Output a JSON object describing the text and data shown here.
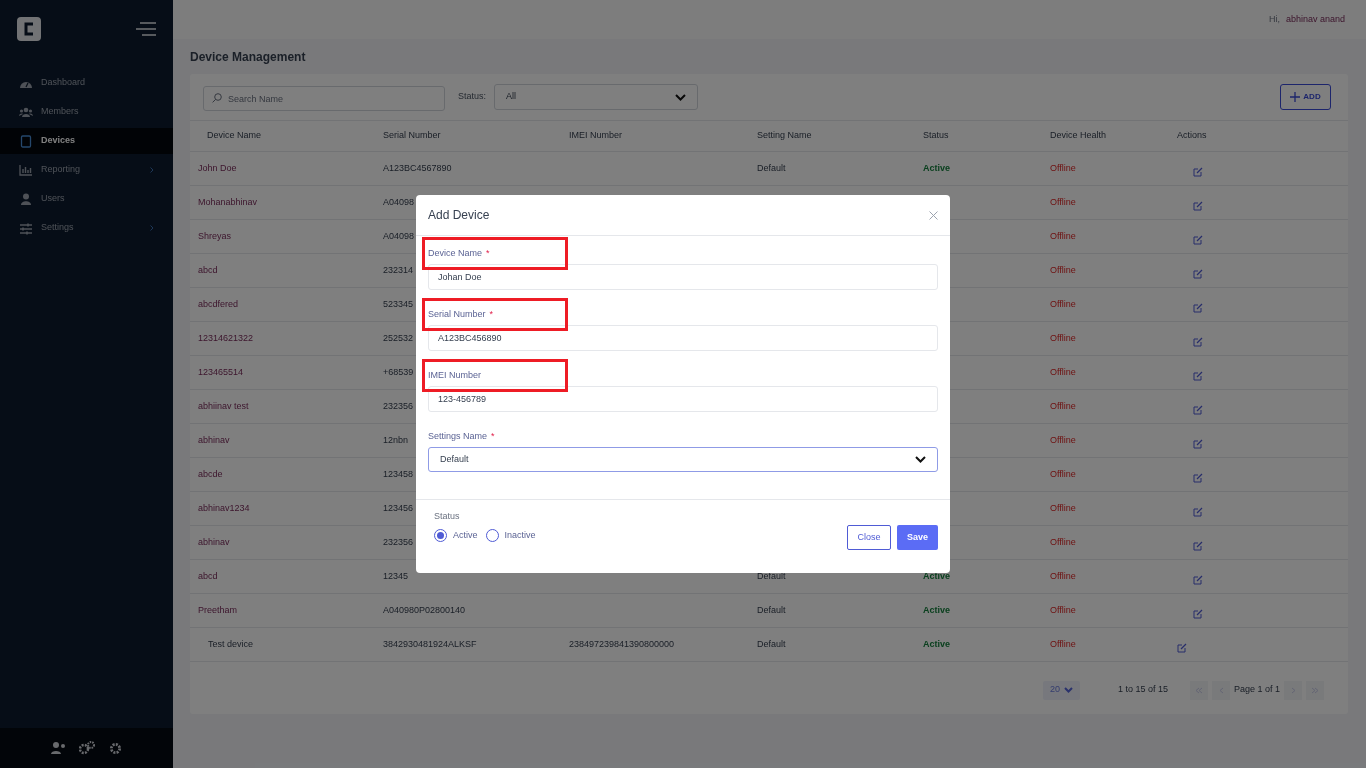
{
  "sidebar": {
    "items": [
      {
        "label": "Dashboard",
        "selected": false,
        "has_submenu": false
      },
      {
        "label": "Members",
        "selected": false,
        "has_submenu": false
      },
      {
        "label": "Devices",
        "selected": true,
        "has_submenu": false
      },
      {
        "label": "Reporting",
        "selected": false,
        "has_submenu": true
      },
      {
        "label": "Users",
        "selected": false,
        "has_submenu": false
      },
      {
        "label": "Settings",
        "selected": false,
        "has_submenu": true
      }
    ]
  },
  "header": {
    "greeting": "Hi,",
    "user_name": "abhinav anand"
  },
  "page_title": "Device Management",
  "toolbar": {
    "search": {
      "placeholder": "Search Name"
    },
    "status_label": "Status:",
    "status_value": "All",
    "add_button": "ADD"
  },
  "table": {
    "columns": [
      "Device Name",
      "Serial Number",
      "IMEI Number",
      "Setting Name",
      "Status",
      "Device Health",
      "Actions"
    ],
    "rows": [
      {
        "device_name": "John Doe",
        "serial_number": "A123BC4567890",
        "setting_name": "Default",
        "status": "Active",
        "health": "Offline"
      },
      {
        "device_name": "Mohanabhinav",
        "serial_number": "A04098",
        "health": "Offline"
      },
      {
        "device_name": "Shreyas",
        "serial_number": "A04098",
        "health": "Offline"
      },
      {
        "device_name": "abcd",
        "serial_number": "232314",
        "health": "Offline"
      },
      {
        "device_name": "abcdfered",
        "serial_number": "523345",
        "health": "Offline"
      },
      {
        "device_name": "12314621322",
        "serial_number": "252532",
        "health": "Offline"
      },
      {
        "device_name": "123465514",
        "serial_number": "+68539",
        "health": "Offline"
      },
      {
        "device_name": "abhiinav test",
        "serial_number": "232356",
        "health": "Offline"
      },
      {
        "device_name": "abhinav",
        "serial_number": "12nbn",
        "health": "Offline"
      },
      {
        "device_name": "abcde",
        "serial_number": "123458",
        "health": "Offline"
      },
      {
        "device_name": "abhinav1234",
        "serial_number": "123456",
        "health": "Offline"
      },
      {
        "device_name": "abhinav",
        "serial_number": "232356",
        "health": "Offline"
      },
      {
        "device_name": "abcd",
        "serial_number": "12345",
        "setting_name": "Default",
        "status": "Active",
        "health": "Offline"
      },
      {
        "device_name": "Preetham",
        "serial_number": "A040980P02800140",
        "setting_name": "Default",
        "status": "Active",
        "health": "Offline"
      },
      {
        "device_name": "Test device",
        "serial_number": "3842930481924ALKSF",
        "imei_number": "238497239841390800000",
        "setting_name": "Default",
        "status": "Active",
        "health": "Offline"
      }
    ]
  },
  "pagination": {
    "page_size": "20",
    "range": "1 to 15 of 15",
    "page": "Page 1 of 1"
  },
  "modal": {
    "title": "Add Device",
    "fields": [
      {
        "kind": "text",
        "label": "Device Name",
        "required_mark": "*",
        "highlighted": true,
        "value": "Johan Doe"
      },
      {
        "kind": "text",
        "label": "Serial Number",
        "required_mark": "*",
        "highlighted": true,
        "value": "A123BC456890"
      },
      {
        "kind": "text",
        "label": "IMEI Number",
        "highlighted": true,
        "value": "123-456789"
      },
      {
        "kind": "select",
        "label": "Settings Name",
        "required_mark": "*",
        "highlighted": false,
        "value": "Default"
      }
    ],
    "status_label": "Status",
    "status_options": [
      {
        "label": "Active",
        "selected": true
      },
      {
        "label": "Inactive",
        "selected": false
      }
    ],
    "buttons": [
      "Close",
      "Save"
    ]
  }
}
